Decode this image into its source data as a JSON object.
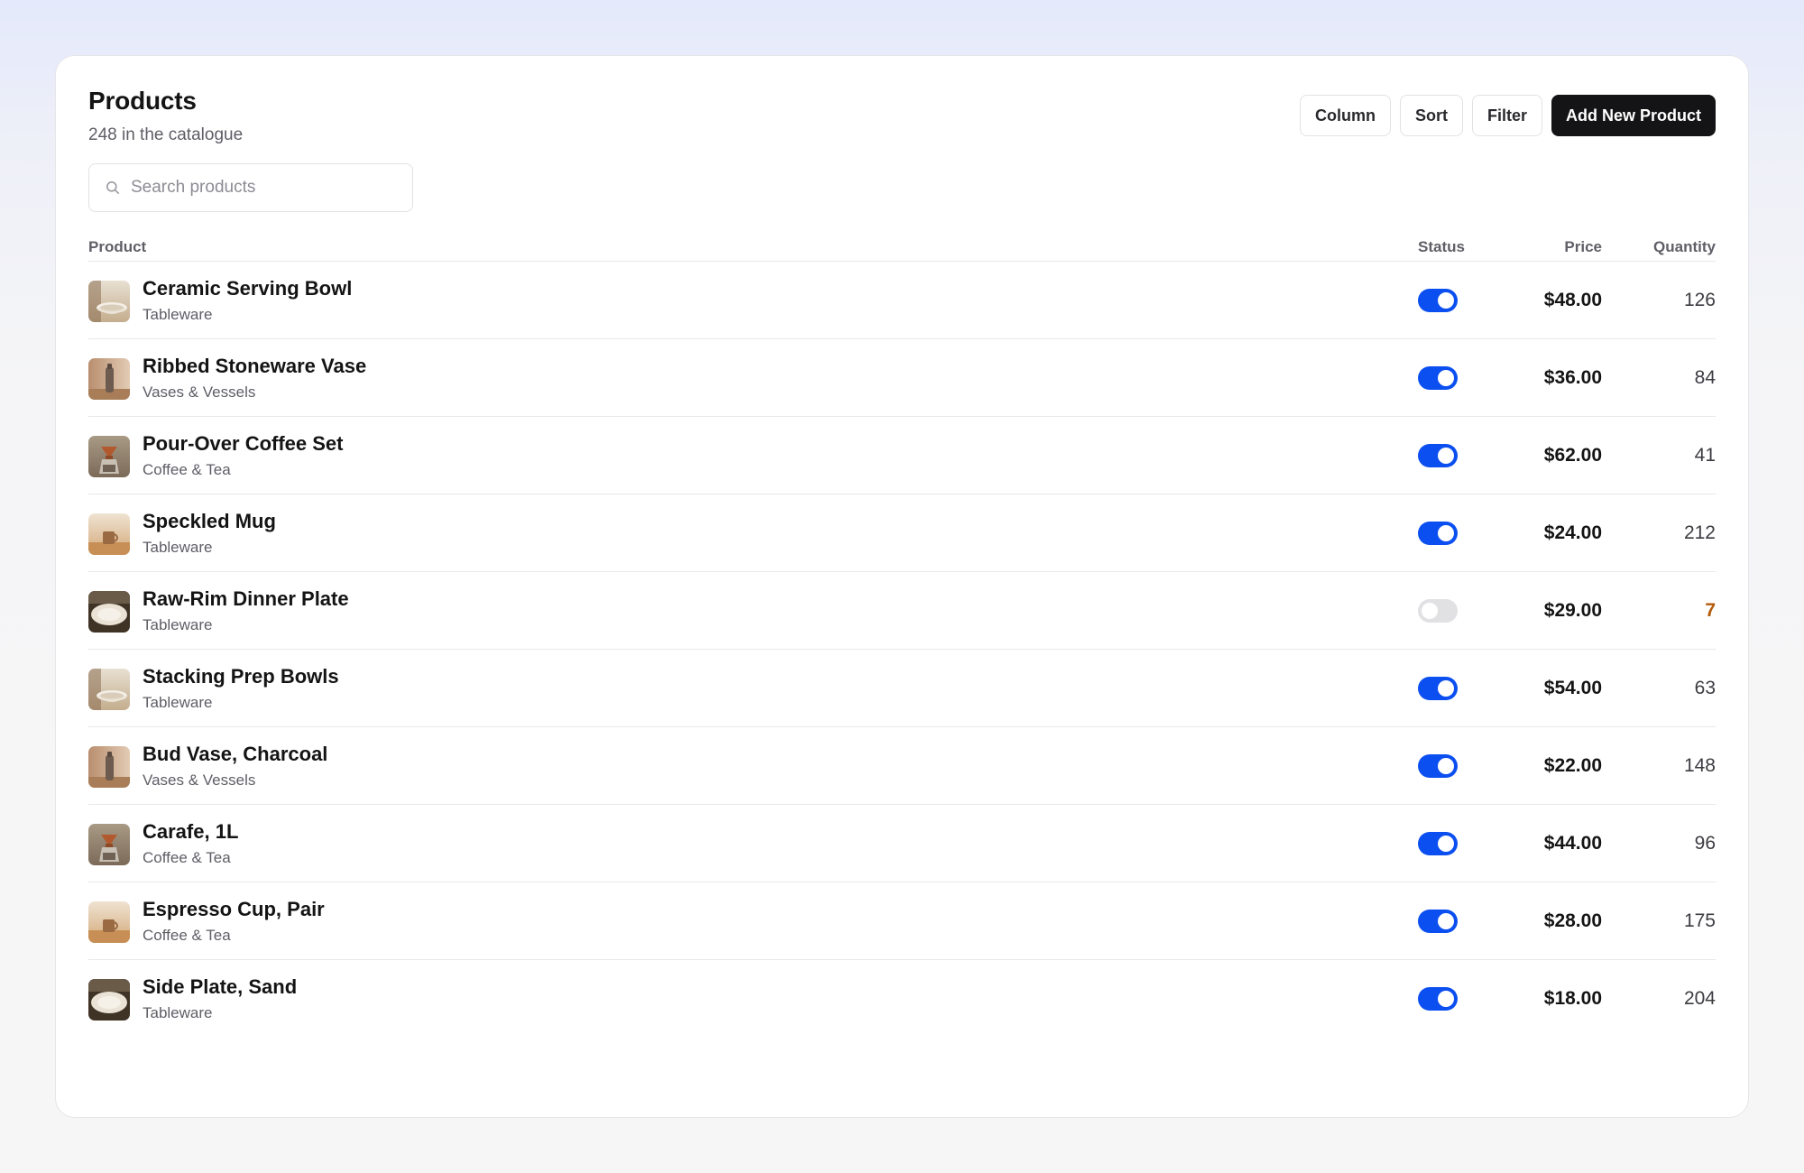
{
  "header": {
    "title": "Products",
    "subtitle": "248 in the catalogue"
  },
  "actions": {
    "column_label": "Column",
    "sort_label": "Sort",
    "filter_label": "Filter",
    "add_label": "Add New Product"
  },
  "search": {
    "placeholder": "Search products",
    "value": ""
  },
  "table": {
    "columns": {
      "product": "Product",
      "status": "Status",
      "price": "Price",
      "quantity": "Quantity"
    },
    "rows": [
      {
        "name": "Ceramic Serving Bowl",
        "category": "Tableware",
        "status": "on",
        "price": "$48.00",
        "quantity": "126",
        "thumb": "bowl"
      },
      {
        "name": "Ribbed Stoneware Vase",
        "category": "Vases & Vessels",
        "status": "on",
        "price": "$36.00",
        "quantity": "84",
        "thumb": "vase"
      },
      {
        "name": "Pour-Over Coffee Set",
        "category": "Coffee & Tea",
        "status": "on",
        "price": "$62.00",
        "quantity": "41",
        "thumb": "coffee"
      },
      {
        "name": "Speckled Mug",
        "category": "Tableware",
        "status": "on",
        "price": "$24.00",
        "quantity": "212",
        "thumb": "mug"
      },
      {
        "name": "Raw-Rim Dinner Plate",
        "category": "Tableware",
        "status": "off",
        "price": "$29.00",
        "quantity": "7",
        "low_stock": true,
        "thumb": "plate"
      },
      {
        "name": "Stacking Prep Bowls",
        "category": "Tableware",
        "status": "on",
        "price": "$54.00",
        "quantity": "63",
        "thumb": "bowl"
      },
      {
        "name": "Bud Vase, Charcoal",
        "category": "Vases & Vessels",
        "status": "on",
        "price": "$22.00",
        "quantity": "148",
        "thumb": "vase"
      },
      {
        "name": "Carafe, 1L",
        "category": "Coffee & Tea",
        "status": "on",
        "price": "$44.00",
        "quantity": "96",
        "thumb": "coffee"
      },
      {
        "name": "Espresso Cup, Pair",
        "category": "Coffee & Tea",
        "status": "on",
        "price": "$28.00",
        "quantity": "175",
        "thumb": "mug"
      },
      {
        "name": "Side Plate, Sand",
        "category": "Tableware",
        "status": "on",
        "price": "$18.00",
        "quantity": "204",
        "thumb": "plate"
      }
    ]
  },
  "colors": {
    "toggle_on": "#0b4ff0",
    "toggle_off": "#e1e1e4",
    "low_stock": "#b45a09",
    "primary_button": "#141416"
  },
  "icons": {
    "search": "search-icon"
  }
}
